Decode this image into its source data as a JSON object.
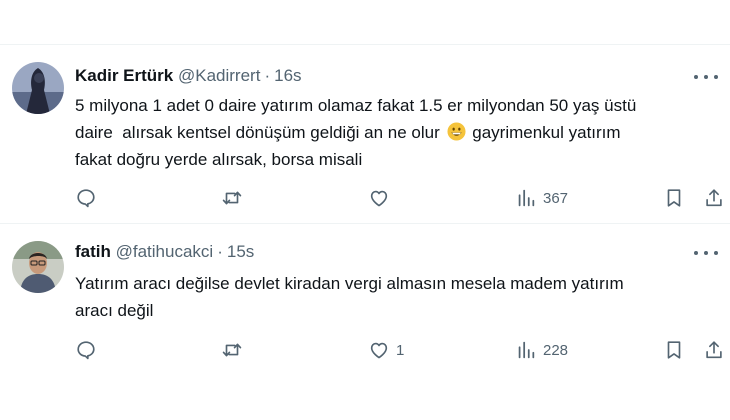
{
  "tweets": [
    {
      "name": "Kadir Ertürk",
      "handle": "@Kadirrert",
      "dot": "·",
      "time": "16s",
      "text_line1": "5 milyona 1 adet 0 daire yatırım olamaz fakat 1.5 er milyondan 50 yaş üstü",
      "text_line2a": "daire  alırsak kentsel dönüşüm geldiği an ne olur",
      "emoji": "grinning-face-emoji",
      "text_line2b": "gayrimenkul yatırım",
      "text_line3": "fakat doğru yerde alırsak, borsa misali",
      "likes": "",
      "views": "367"
    },
    {
      "name": "fatih",
      "handle": "@fatihucakci",
      "dot": "·",
      "time": "15s",
      "text_line1": "Yatırım aracı değilse devlet kiradan vergi almasın mesela madem yatırım",
      "text_line2": "aracı değil",
      "likes": "1",
      "views": "228"
    }
  ],
  "icons": [
    "reply-icon",
    "retweet-icon",
    "like-icon",
    "views-icon",
    "bookmark-icon",
    "share-icon",
    "more-icon"
  ],
  "colors": {
    "text": "#0f1419",
    "secondary": "#536471",
    "divider": "#eff3f4"
  }
}
